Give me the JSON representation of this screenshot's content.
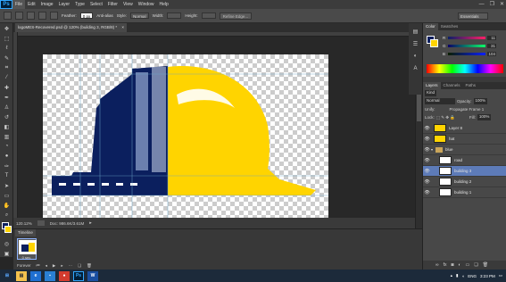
{
  "app": {
    "logo": "Ps",
    "window_controls": [
      "—",
      "❐",
      "✕"
    ]
  },
  "menu": [
    "File",
    "Edit",
    "Image",
    "Layer",
    "Type",
    "Select",
    "Filter",
    "View",
    "Window",
    "Help"
  ],
  "options": {
    "feather_label": "Feather:",
    "feather_value": "0 px",
    "antialias_label": "Anti-alias",
    "style_label": "Style:",
    "style_value": "Normal",
    "width_label": "Width:",
    "height_label": "Height:",
    "refine_label": "Refine Edge...",
    "workspace": "Essentials"
  },
  "document": {
    "tab_title": "logoMES-Recovered.psd @ 120% (building 3, RGB/8) *",
    "close": "×",
    "zoom": "120.12%",
    "doc_size": "Doc: 986.6K/3.61M"
  },
  "colors": {
    "navy": "#0b1f5e",
    "yellow": "#ffd400",
    "selection": "#5d7bb8"
  },
  "timeline": {
    "tab": "Timeline",
    "frame_time": "0 sec.",
    "loop": "Forever"
  },
  "color_panel": {
    "tabs": [
      "Color",
      "Swatches"
    ],
    "r": "11",
    "g": "31",
    "b": "104"
  },
  "layers_panel": {
    "tabs": [
      "Layers",
      "Channels",
      "Paths"
    ],
    "kind": "Kind",
    "blend": "Normal",
    "opacity_label": "Opacity:",
    "opacity": "100%",
    "unify_label": "Unify:",
    "propagate": "Propagate Frame 1",
    "lock_label": "Lock:",
    "fill_label": "Fill:",
    "fill": "100%",
    "layers": [
      {
        "name": "Layer 8",
        "type": "layer",
        "selected": false,
        "indent": 0
      },
      {
        "name": "hat",
        "type": "layer",
        "selected": false,
        "indent": 0
      },
      {
        "name": "blue",
        "type": "group",
        "selected": false,
        "indent": 0
      },
      {
        "name": "road",
        "type": "layer",
        "selected": false,
        "indent": 1
      },
      {
        "name": "building 3",
        "type": "layer",
        "selected": true,
        "indent": 1
      },
      {
        "name": "building 2",
        "type": "layer",
        "selected": false,
        "indent": 1
      },
      {
        "name": "building 1",
        "type": "layer",
        "selected": false,
        "indent": 1
      }
    ]
  },
  "taskbar": {
    "lang": "ENG",
    "time": "3:23 PM"
  }
}
